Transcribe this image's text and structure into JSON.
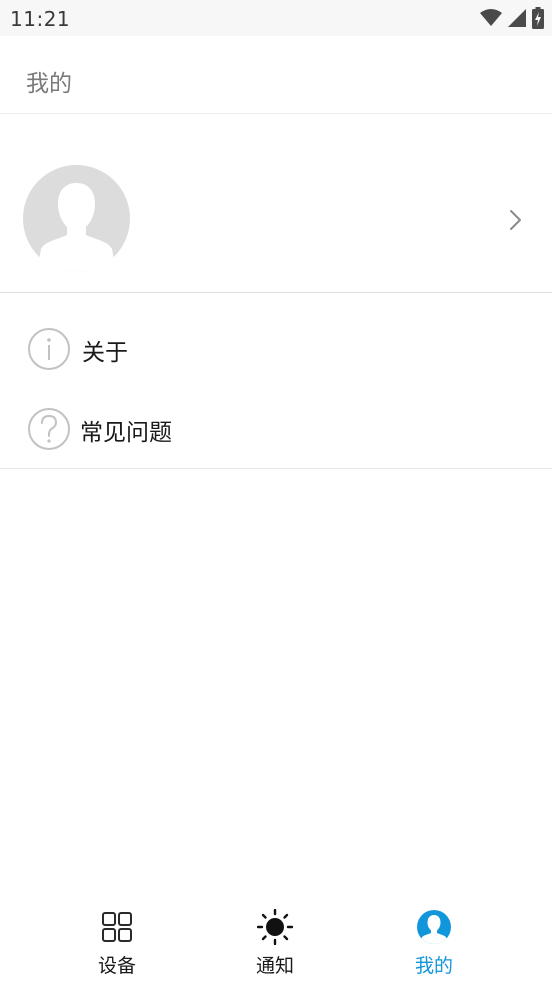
{
  "status_bar": {
    "time": "11:21"
  },
  "app_bar": {
    "title": "我的"
  },
  "menu": {
    "items": [
      {
        "label": "关于",
        "icon": "info-icon"
      },
      {
        "label": "常见问题",
        "icon": "help-icon"
      }
    ]
  },
  "bottom_nav": {
    "items": [
      {
        "label": "设备",
        "icon": "grid-icon"
      },
      {
        "label": "通知",
        "icon": "sun-icon"
      },
      {
        "label": "我的",
        "icon": "person-icon",
        "active": true
      }
    ],
    "active_color": "#1296db"
  },
  "colors": {
    "accent": "#1296db",
    "avatar_bg": "#dcdcdc"
  }
}
